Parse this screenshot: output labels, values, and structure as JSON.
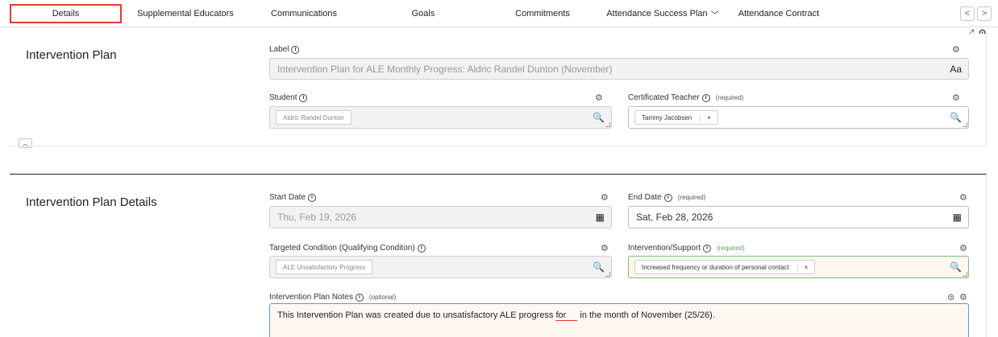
{
  "tabs": [
    {
      "label": "Details",
      "active": true
    },
    {
      "label": "Supplemental Educators"
    },
    {
      "label": "Communications"
    },
    {
      "label": "Goals"
    },
    {
      "label": "Commitments"
    },
    {
      "label": "Attendance Success Plan",
      "has_dropdown": true
    },
    {
      "label": "Attendance Contract"
    }
  ],
  "nav": {
    "prev": "<",
    "next": ">"
  },
  "section1": {
    "title": "Intervention Plan",
    "label_field": {
      "label": "Label",
      "value": "Intervention Plan for ALE Monthly Progress: Aldric Randel Dunton (November)",
      "icon_text": "Aa"
    },
    "student_field": {
      "label": "Student",
      "chip": "Aldric Randel Dunton"
    },
    "teacher_field": {
      "label": "Certificated Teacher",
      "required": "(required)",
      "chip": "Tammy Jacobsen",
      "remove": "×"
    }
  },
  "section2": {
    "title": "Intervention Plan Details",
    "start_date": {
      "label": "Start Date",
      "value": "Thu, Feb 19, 2026"
    },
    "end_date": {
      "label": "End Date",
      "required": "(required)",
      "value": "Sat, Feb 28, 2026"
    },
    "condition": {
      "label": "Targeted Condition (Qualifying Conditon)",
      "chip": "ALE Unsatisfactory Progress"
    },
    "intervention": {
      "label": "Intervention/Support",
      "required": "(required)",
      "chip": "Increased frequency or duration of personal contact",
      "remove": "×"
    },
    "notes": {
      "label": "Intervention Plan Notes",
      "optional": "(optional)",
      "text_before": "This Intervention Plan was created due to unsatisfactory ALE progress ",
      "text_squiggle": "for",
      "text_after": " in the month of November (25/26)."
    }
  },
  "icons": {
    "gear": "gear-icon",
    "info": "info-icon",
    "search": "magnify-plus-icon",
    "calendar": "calendar-icon",
    "expand": "expand-icon",
    "collapse": "chevron-up-icon"
  }
}
